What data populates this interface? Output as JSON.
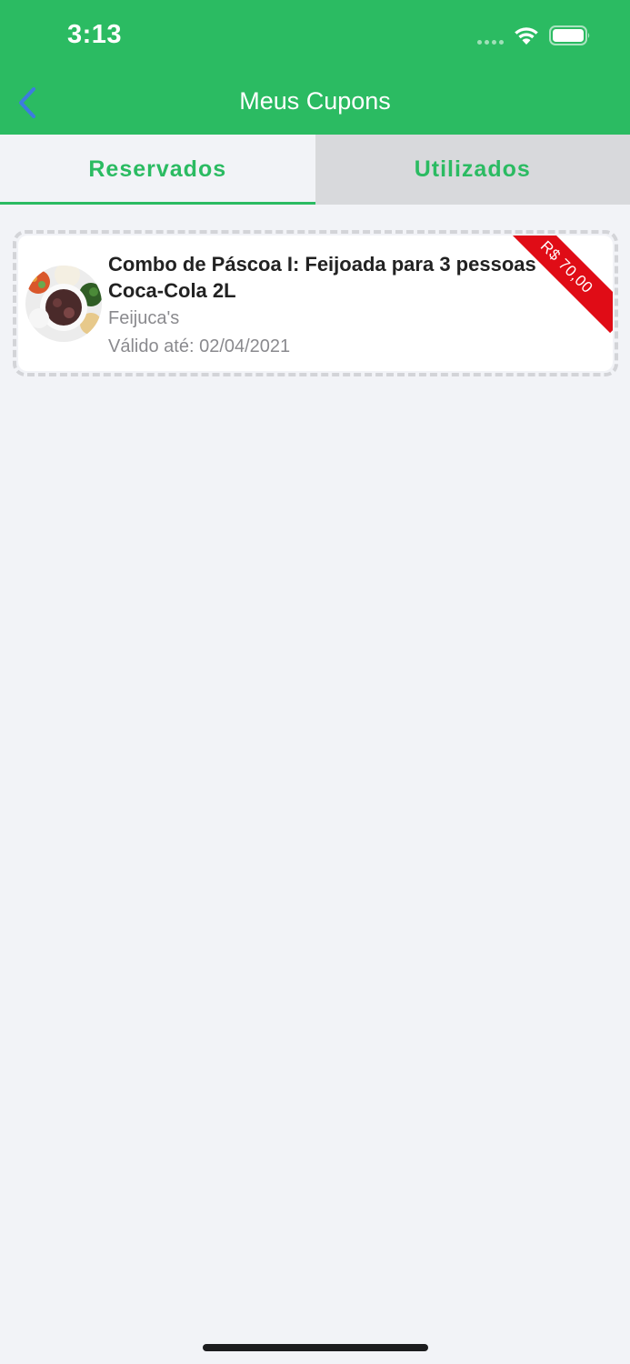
{
  "status_bar": {
    "time": "3:13"
  },
  "nav": {
    "title": "Meus Cupons"
  },
  "tabs": [
    {
      "label": "Reservados",
      "active": true
    },
    {
      "label": "Utilizados",
      "active": false
    }
  ],
  "coupons": [
    {
      "title": "Combo de Páscoa I: Feijoada para 3 pessoas + Coca-Cola 2L",
      "store": "Feijuca's",
      "valid_until": "Válido até: 02/04/2021",
      "price": "R$ 70,00"
    }
  ],
  "colors": {
    "primary": "#2bbb62",
    "ribbon": "#e00c16",
    "background": "#f2f3f7",
    "inactive_tab": "#d8d9dc"
  }
}
